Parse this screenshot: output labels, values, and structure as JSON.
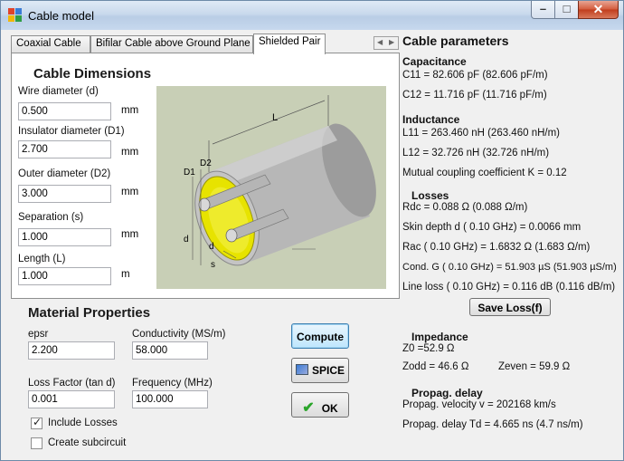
{
  "window": {
    "title": "Cable model"
  },
  "tabs": [
    {
      "label": "Coaxial Cable"
    },
    {
      "label": "Bifilar Cable above Ground Plane"
    },
    {
      "label": "Shielded Pair"
    }
  ],
  "dimensions": {
    "heading": "Cable Dimensions",
    "wire_label": "Wire diameter (d)",
    "wire_value": "0.500",
    "wire_unit": "mm",
    "ins_label": "Insulator diameter (D1)",
    "ins_value": "2.700",
    "ins_unit": "mm",
    "outer_label": "Outer diameter (D2)",
    "outer_value": "3.000",
    "outer_unit": "mm",
    "sep_label": "Separation (s)",
    "sep_value": "1.000",
    "sep_unit": "mm",
    "len_label": "Length (L)",
    "len_value": "1.000",
    "len_unit": "m"
  },
  "diagram": {
    "L": "L",
    "D2": "D2",
    "D1": "D1",
    "d1": "d",
    "d2": "d",
    "s": "s"
  },
  "material": {
    "heading": "Material Properties",
    "epsr_label": "epsr",
    "epsr_value": "2.200",
    "cond_label": "Conductivity (MS/m)",
    "cond_value": "58.000",
    "loss_label": "Loss Factor (tan d)",
    "loss_value": "0.001",
    "freq_label": "Frequency (MHz)",
    "freq_value": "100.000",
    "include_losses": "Include Losses",
    "create_subcircuit": "Create subcircuit"
  },
  "buttons": {
    "compute": "Compute",
    "spice": "SPICE",
    "ok": "OK",
    "save_loss": "Save Loss(f)"
  },
  "params": {
    "heading": "Cable parameters",
    "cap_h": "Capacitance",
    "c11": "C11 = 82.606 pF (82.606 pF/m)",
    "c12": "C12 = 11.716 pF (11.716 pF/m)",
    "ind_h": "Inductance",
    "l11": "L11 = 263.460 nH (263.460 nH/m)",
    "l12": "L12 = 32.726 nH (32.726 nH/m)",
    "mutual": "Mutual coupling coefficient K =  0.12",
    "loss_h": "Losses",
    "rdc": "Rdc = 0.088 Ω (0.088 Ω/m)",
    "skin": "Skin depth d ( 0.10 GHz) = 0.0066 mm",
    "rac": "Rac ( 0.10 GHz) = 1.6832 Ω (1.683 Ω/m)",
    "condg": "Cond. G ( 0.10 GHz) = 51.903 µS (51.903 µS/m)",
    "lineloss": "Line loss ( 0.10 GHz) = 0.116 dB (0.116 dB/m)",
    "imp_h": "Impedance",
    "z0": "Z0 =52.9 Ω",
    "zodd": "Zodd = 46.6 Ω",
    "zeven": "Zeven = 59.9 Ω",
    "prop_h": "Propag. delay",
    "vel": "Propag. velocity v = 202168 km/s",
    "delay": "Propag. delay Td = 4.665 ns (4.7 ns/m)"
  },
  "colors": {
    "accent": "#3c7fb1",
    "insulator": "#e7e300",
    "shield": "#c0c0c0"
  },
  "state": {
    "include_losses_checked": true,
    "create_subcircuit_checked": false
  }
}
